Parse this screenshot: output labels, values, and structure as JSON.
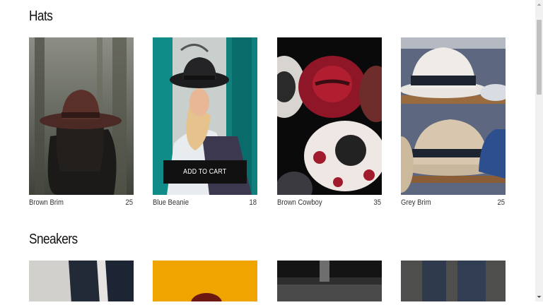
{
  "sections": [
    {
      "title": "Hats",
      "items": [
        {
          "name": "Brown Brim",
          "price": "25"
        },
        {
          "name": "Blue Beanie",
          "price": "18"
        },
        {
          "name": "Brown Cowboy",
          "price": "35"
        },
        {
          "name": "Grey Brim",
          "price": "25"
        }
      ]
    },
    {
      "title": "Sneakers"
    }
  ],
  "add_to_cart_label": "ADD TO CART",
  "colors": {
    "button_bg": "#111111",
    "button_text": "#ffffff",
    "scrollbar_thumb": "#c1c1c1"
  }
}
